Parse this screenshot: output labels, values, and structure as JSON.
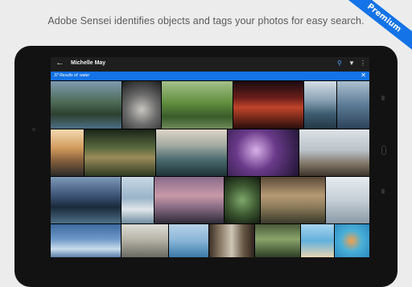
{
  "headline": "Adobe Sensei identifies objects and tags your photos for easy search.",
  "ribbon": "Premium",
  "appbar": {
    "back_icon": "arrow-left-icon",
    "title": "Michelle May",
    "search_icon": "search-icon",
    "filter_icon": "filter-icon",
    "more_icon": "more-vertical-icon"
  },
  "search_result": {
    "text": "37 Results of: water",
    "close_icon": "close-icon"
  },
  "colors": {
    "accent": "#1473e6",
    "appbar": "#1e1e1e",
    "tablet": "#121212"
  },
  "photos": [
    {
      "subject": "lake with pine trees",
      "bg": "linear-gradient(180deg,#7e9bb0 0%,#4d6a55 45%,#2e4030 70%,#4b6f86 100%)"
    },
    {
      "subject": "feet in stream",
      "bg": "radial-gradient(circle at 50% 60%,#c9c6c0 0%,#6b6b6b 45%,#1c1c1c 100%)"
    },
    {
      "subject": "willow trees over water",
      "bg": "linear-gradient(180deg,#a4c08a 0%,#62903f 45%,#3a5b2a 75%,#6f8a5a 100%)"
    },
    {
      "subject": "red sunset lake",
      "bg": "linear-gradient(180deg,#1a0c10 0%,#6a1e1a 35%,#c0442a 55%,#2a0e0c 100%)"
    },
    {
      "subject": "kayak on glacier lake",
      "bg": "linear-gradient(180deg,#d5dde4 0%,#8aa2b5 40%,#3c5a6e 70%,#233744 100%)"
    },
    {
      "subject": "kayak pond",
      "bg": "linear-gradient(180deg,#adc0d0 0%,#5c7b96 50%,#2c4258 100%)"
    },
    {
      "subject": "desert river canyon",
      "bg": "linear-gradient(180deg,#f2d9b0 0%,#d29a5c 40%,#7d5a3a 70%,#2b2a28 100%)"
    },
    {
      "subject": "stone bridge forest",
      "bg": "linear-gradient(180deg,#1a2418 0%,#5a6a3e 40%,#9a8c5a 60%,#2e3a22 100%)"
    },
    {
      "subject": "rocky coastline",
      "bg": "linear-gradient(180deg,#ddd6c8 0%,#a0a8a0 35%,#4a6a6e 65%,#1e3236 100%)"
    },
    {
      "subject": "purple flowers under water",
      "bg": "radial-gradient(circle at 40% 45%,#d8b0e8 0%,#6a3a8a 40%,#1e1430 100%)"
    },
    {
      "subject": "misty shore",
      "bg": "linear-gradient(180deg,#dde2e6 0%,#b9c2c8 45%,#7e7262 75%,#3c342a 100%)"
    },
    {
      "subject": "campfire by lake",
      "bg": "linear-gradient(180deg,#7f9ab8 0%,#3c5476 40%,#1a2a3a 65%,#4e7088 100%)"
    },
    {
      "subject": "marsh grass",
      "bg": "linear-gradient(180deg,#c8d8e6 0%,#9ab4c8 45%,#e0e6ea 70%,#6f8c9e 100%)"
    },
    {
      "subject": "pink dusk lake",
      "bg": "linear-gradient(180deg,#8a6a8a 0%,#c89aa8 40%,#8a6c84 65%,#2e2a36 100%)"
    },
    {
      "subject": "fern closeup",
      "bg": "radial-gradient(circle at 50% 50%,#7ea86a 0%,#3e5a32 50%,#121a10 100%)"
    },
    {
      "subject": "hands holding trout",
      "bg": "linear-gradient(180deg,#5a4a38 0%,#b69a74 40%,#8a7a5a 65%,#3a3a2a 100%)"
    },
    {
      "subject": "heron by water",
      "bg": "linear-gradient(180deg,#e6ecf0 0%,#c4ced6 50%,#8a9aa6 100%)"
    },
    {
      "subject": "icebergs at twilight",
      "bg": "linear-gradient(180deg,#3e6aa0 0%,#6e98c8 45%,#c8dcec 75%,#5a7ea6 100%)"
    },
    {
      "subject": "people jumping into sea",
      "bg": "linear-gradient(180deg,#dcdcd6 0%,#b8b4a8 45%,#6a6a62 100%)"
    },
    {
      "subject": "ocean horizon",
      "bg": "linear-gradient(180deg,#b8d2e8 0%,#88b4d6 50%,#3a78a8 100%)"
    },
    {
      "subject": "pier pilings",
      "bg": "linear-gradient(90deg,#3a3026 0%,#8a7a66 25%,#cfc6b6 50%,#6a5a48 75%,#2e241c 100%)"
    },
    {
      "subject": "stream with moss",
      "bg": "linear-gradient(180deg,#4a5a3a 0%,#8aa46a 45%,#2e3e26 100%)"
    },
    {
      "subject": "palm beach",
      "bg": "linear-gradient(180deg,#a8d4ee 0%,#62b0dc 50%,#e8d6b0 100%)"
    },
    {
      "subject": "pool floats",
      "bg": "radial-gradient(circle at 40% 50%,#f2a050 0%,#4ab0d8 35%,#1e78b8 100%)"
    }
  ]
}
